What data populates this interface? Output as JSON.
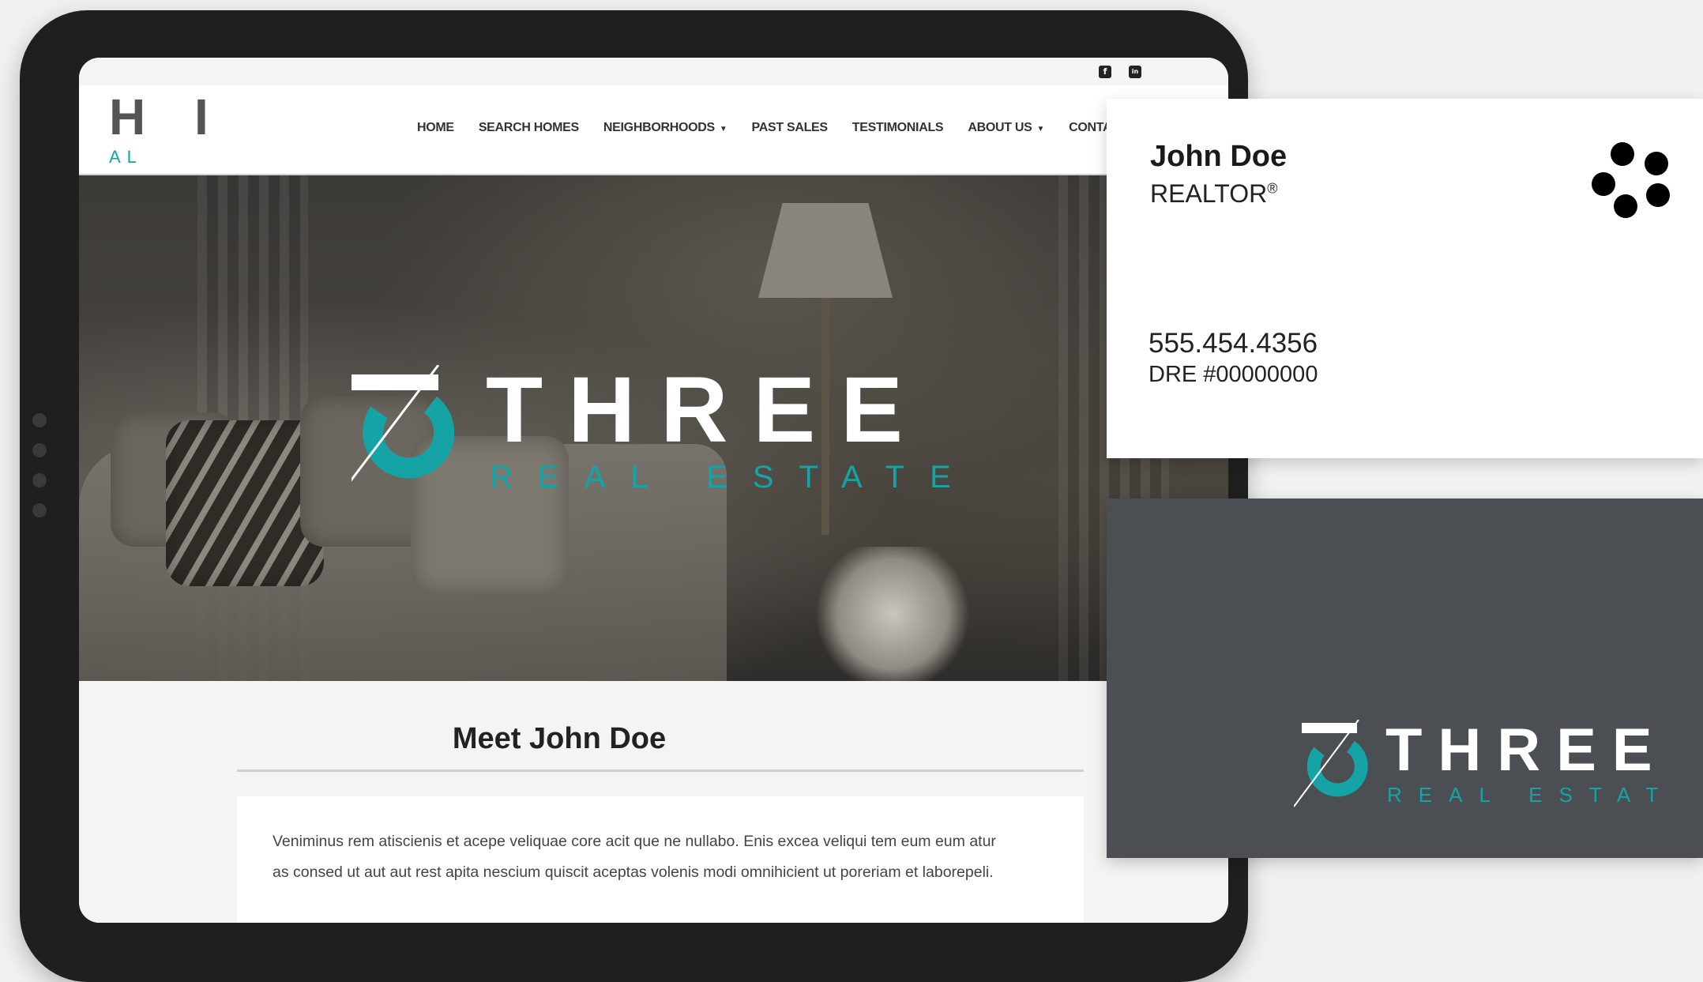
{
  "site": {
    "logo_main": "H I",
    "logo_sub": "AL",
    "social": [
      {
        "icon": "facebook-icon",
        "glyph": "f"
      },
      {
        "icon": "linkedin-icon",
        "glyph": "in"
      }
    ],
    "nav": [
      {
        "label": "HOME"
      },
      {
        "label": "SEARCH HOMES"
      },
      {
        "label": "NEIGHBORHOODS",
        "caret": "▼"
      },
      {
        "label": "PAST SALES"
      },
      {
        "label": "TESTIMONIALS"
      },
      {
        "label": "ABOUT US",
        "caret": "▼"
      },
      {
        "label": "CONTAC"
      }
    ],
    "hero": {
      "brand_main": "THREE",
      "brand_sub": "REAL ESTATE"
    },
    "meet_title": "Meet John Doe",
    "bio_line1": "Veniminus rem atiscienis et acepe veliquae core acit que ne nullabo. Enis excea veliqui tem eum eum atur",
    "bio_line2": "as consed ut aut aut rest apita nescium quiscit aceptas volenis modi omnihicient ut poreriam et laborepeli."
  },
  "business_card": {
    "front": {
      "name": "John Doe",
      "title": "REALTOR",
      "title_mark": "®",
      "phone": "555.454.4356",
      "license": "DRE #00000000"
    },
    "back": {
      "brand_main": "THREE",
      "brand_sub": "REAL ESTATE"
    }
  },
  "colors": {
    "accent_teal": "#16a3a5",
    "card_back": "#4b4f53",
    "tablet_frame": "#1f1f1f"
  }
}
